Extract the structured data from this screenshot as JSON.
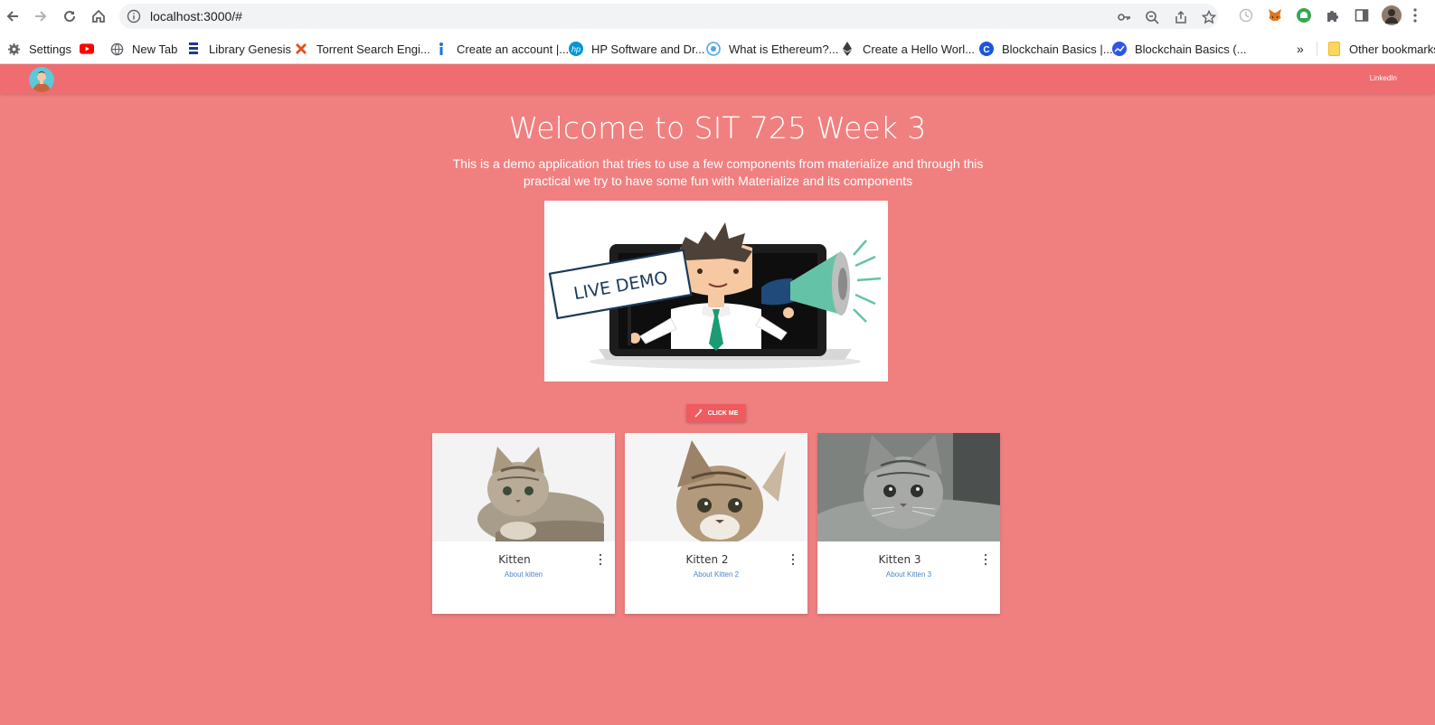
{
  "browser": {
    "url": "localhost:3000/#",
    "bookmarks": [
      {
        "label": "Settings",
        "icon": "gear-icon"
      },
      {
        "label": "",
        "icon": "youtube-icon"
      },
      {
        "label": "New Tab",
        "icon": "globe-icon"
      },
      {
        "label": "Library Genesis",
        "icon": "libgen-icon"
      },
      {
        "label": "Torrent Search Engi...",
        "icon": "x-icon"
      },
      {
        "label": "Create an account |...",
        "icon": "info-icon"
      },
      {
        "label": "HP Software and Dr...",
        "icon": "hp-icon"
      },
      {
        "label": "What is Ethereum?...",
        "icon": "ethereum-site-icon"
      },
      {
        "label": "Create a Hello Worl...",
        "icon": "ethereum-icon"
      },
      {
        "label": "Blockchain Basics |...",
        "icon": "c-icon"
      },
      {
        "label": "Blockchain Basics (...",
        "icon": "chart-icon"
      }
    ],
    "other_bookmarks": "Other bookmarks"
  },
  "nav": {
    "link": "LinkedIn"
  },
  "hero": {
    "title": "Welcome to SIT 725 Week 3",
    "subtitle": "This is a demo application that tries to use a few components from materialize and through this practical we try to have some fun with Materialize and its components",
    "image_text": "LIVE DEMO"
  },
  "button": {
    "label": "CLICK ME"
  },
  "cards": [
    {
      "title": "Kitten",
      "link": "About kitten"
    },
    {
      "title": "Kitten 2",
      "link": "About Kitten 2"
    },
    {
      "title": "Kitten 3",
      "link": "About Kitten 3"
    }
  ],
  "colors": {
    "page_bg": "#f08080",
    "nav_bg": "#ef6c70",
    "button_bg": "#ef5b5f",
    "link": "#4a86c8"
  }
}
